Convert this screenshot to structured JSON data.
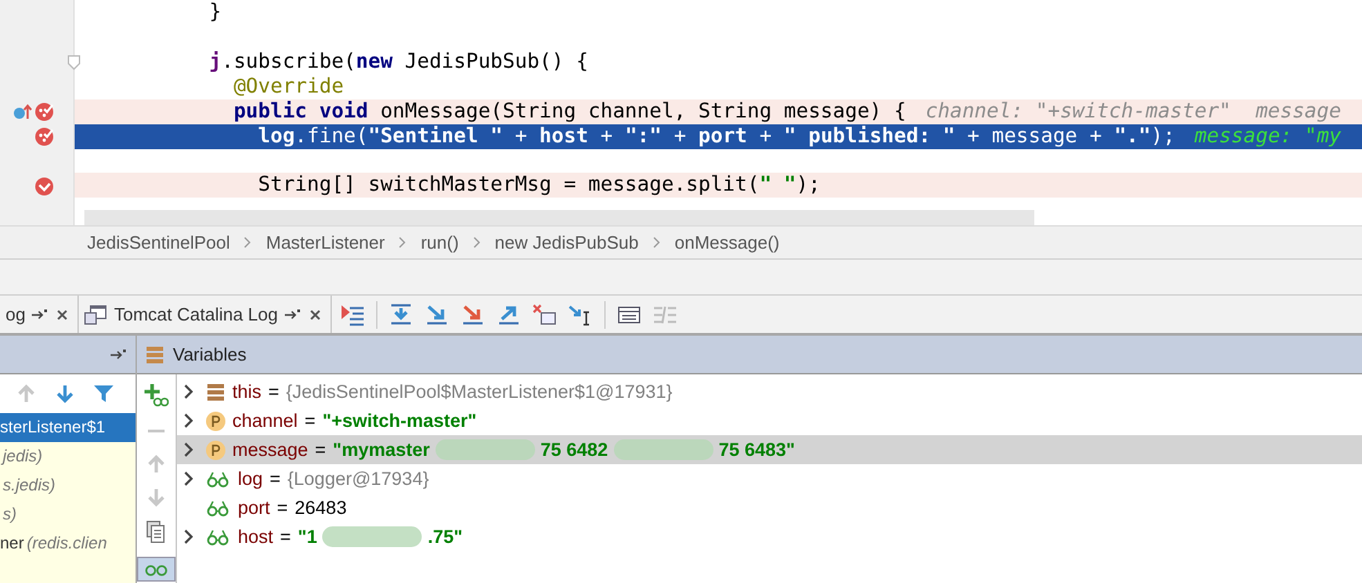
{
  "editor": {
    "lines": [
      {
        "kind": "code",
        "selected": false,
        "breakpoint": false,
        "tokens": [
          {
            "t": "           }",
            "kind": "plain"
          }
        ]
      },
      {
        "kind": "blank",
        "selected": false,
        "breakpoint": false
      },
      {
        "kind": "code",
        "selected": false,
        "breakpoint": false,
        "foldable": true,
        "tokens": [
          {
            "t": "           j",
            "kind": "field"
          },
          {
            "t": ".subscribe(",
            "kind": "plain"
          },
          {
            "t": "new",
            "kind": "keyword"
          },
          {
            "t": " JedisPubSub() {",
            "kind": "plain"
          }
        ]
      },
      {
        "kind": "code",
        "selected": false,
        "breakpoint": false,
        "tokens": [
          {
            "t": "             @Override",
            "kind": "annotation"
          }
        ]
      },
      {
        "kind": "code",
        "selected": false,
        "breakpoint": true,
        "gutter": [
          {
            "kind": "override"
          },
          {
            "kind": "method_breakpoint"
          }
        ],
        "tokens": [
          {
            "t": "             public void",
            "kind": "keyword"
          },
          {
            "t": " onMessage(String channel, String message) {",
            "kind": "plain"
          }
        ],
        "hint": "channel: \"+switch-master\"  message"
      },
      {
        "kind": "code",
        "selected": true,
        "gutter": [
          {
            "kind": "method_breakpoint"
          }
        ],
        "tokens": [
          {
            "t": "               log",
            "kind": "field"
          },
          {
            "t": ".fine(",
            "kind": "plain"
          },
          {
            "t": "\"Sentinel \"",
            "kind": "string"
          },
          {
            "t": " + ",
            "kind": "plain"
          },
          {
            "t": "host",
            "kind": "field"
          },
          {
            "t": " + ",
            "kind": "plain"
          },
          {
            "t": "\":\"",
            "kind": "string"
          },
          {
            "t": " + ",
            "kind": "plain"
          },
          {
            "t": "port",
            "kind": "field"
          },
          {
            "t": " + ",
            "kind": "plain"
          },
          {
            "t": "\" published: \"",
            "kind": "string"
          },
          {
            "t": " + message + ",
            "kind": "plain"
          },
          {
            "t": "\".\"",
            "kind": "string"
          },
          {
            "t": ");",
            "kind": "plain"
          }
        ],
        "hint": "message: \"my"
      },
      {
        "kind": "blank",
        "selected": false,
        "breakpoint": false
      },
      {
        "kind": "code",
        "selected": false,
        "breakpoint": true,
        "gutter": [
          {
            "kind": "line_breakpoint"
          }
        ],
        "tokens": [
          {
            "t": "               String[] switchMasterMsg = message.split(",
            "kind": "plain"
          },
          {
            "t": "\" \"",
            "kind": "string"
          },
          {
            "t": ");",
            "kind": "plain"
          }
        ]
      }
    ]
  },
  "breadcrumbs": [
    "JedisSentinelPool",
    "MasterListener",
    "run()",
    "new JedisPubSub",
    "onMessage()"
  ],
  "tabs": [
    {
      "label": "og",
      "selected": false,
      "icon": false
    },
    {
      "label": "Tomcat Catalina Log",
      "selected": false,
      "icon": true
    }
  ],
  "frames_panel": {
    "frames": [
      {
        "name": "sterListener$1",
        "selected": true
      },
      {
        "location": "jedis)",
        "selected": false
      },
      {
        "location": "s.jedis)",
        "selected": false
      },
      {
        "location": "s)",
        "selected": false
      },
      {
        "name": "ner",
        "location": "(redis.clien",
        "selected": false
      }
    ]
  },
  "variables": {
    "title": "Variables",
    "items": [
      {
        "kind": "object",
        "expandable": true,
        "selected": false,
        "name": "this",
        "operator": "=",
        "value": [
          {
            "kind": "object",
            "text": "{JedisSentinelPool$MasterListener$1@17931}"
          }
        ]
      },
      {
        "kind": "param",
        "expandable": true,
        "selected": false,
        "name": "channel",
        "operator": "=",
        "value": [
          {
            "kind": "string",
            "text": "\"+switch-master\""
          }
        ]
      },
      {
        "kind": "param",
        "expandable": true,
        "selected": true,
        "name": "message",
        "operator": "=",
        "value": [
          {
            "kind": "string",
            "text": "\"mymaster"
          },
          {
            "kind": "redacted"
          },
          {
            "kind": "string",
            "text": "75 6482"
          },
          {
            "kind": "redacted"
          },
          {
            "kind": "string",
            "text": "75 6483\""
          }
        ]
      },
      {
        "kind": "field",
        "expandable": true,
        "selected": false,
        "name": "log",
        "operator": "=",
        "value": [
          {
            "kind": "object",
            "text": "{Logger@17934}"
          }
        ]
      },
      {
        "kind": "field",
        "expandable": false,
        "selected": false,
        "name": "port",
        "operator": "=",
        "value": [
          {
            "kind": "number",
            "text": "26483"
          }
        ]
      },
      {
        "kind": "field",
        "expandable": true,
        "selected": false,
        "name": "host",
        "operator": "=",
        "value": [
          {
            "kind": "string",
            "text": "\"1"
          },
          {
            "kind": "redacted"
          },
          {
            "kind": "string",
            "text": ".75\""
          }
        ]
      }
    ]
  }
}
